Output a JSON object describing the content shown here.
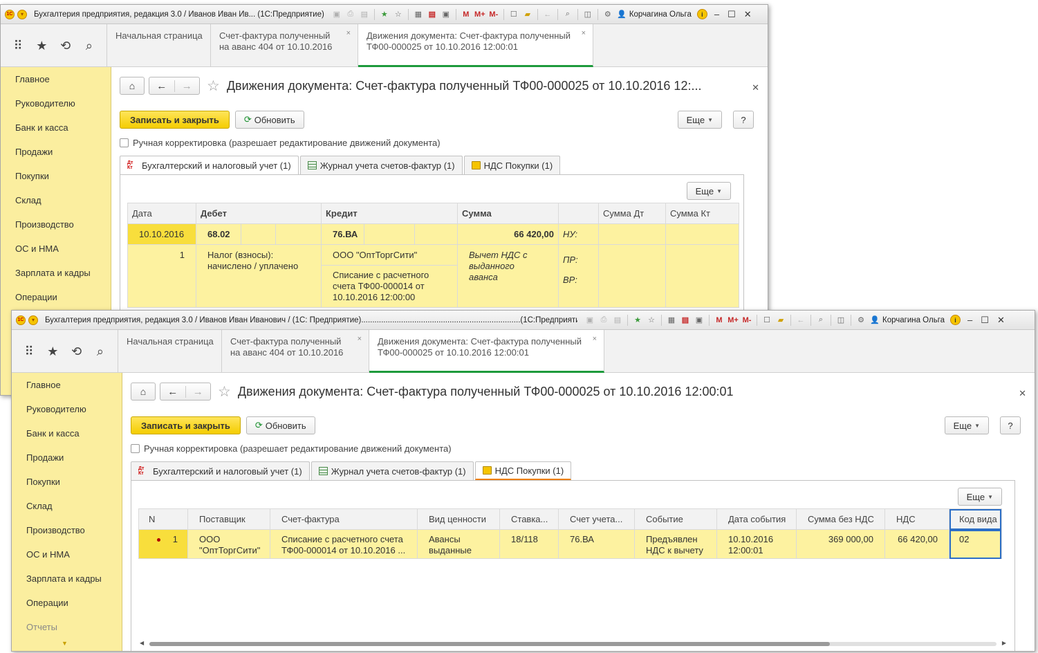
{
  "window1": {
    "title": "Бухгалтерия предприятия, редакция 3.0 / Иванов Иван Ив...  (1С:Предприятие)",
    "user": "Корчагина Ольга",
    "open_tabs": [
      {
        "label": "Начальная страница"
      },
      {
        "label": "Счет-фактура полученный\nна аванс 404 от 10.10.2016"
      },
      {
        "label": "Движения документа: Счет-фактура полученный\nТФ00-000025 от 10.10.2016 12:00:01"
      }
    ],
    "sections": [
      "Главное",
      "Руководителю",
      "Банк и касса",
      "Продажи",
      "Покупки",
      "Склад",
      "Производство",
      "ОС и НМА",
      "Зарплата и кадры",
      "Операции"
    ],
    "form_title": "Движения документа: Счет-фактура полученный ТФ00-000025 от 10.10.2016 12:...",
    "save_close": "Записать и закрыть",
    "refresh": "Обновить",
    "more": "Еще",
    "help": "?",
    "manual_edit": "Ручная корректировка (разрешает редактирование движений документа)",
    "panel_tabs": [
      "Бухгалтерский и налоговый учет (1)",
      "Журнал учета счетов-фактур (1)",
      "НДС Покупки (1)"
    ],
    "panel_more": "Еще",
    "grid": {
      "headers": {
        "date": "Дата",
        "debit": "Дебет",
        "credit": "Кредит",
        "sum": "Сумма",
        "sum_dt": "Сумма Дт",
        "sum_kt": "Сумма Кт"
      },
      "row": {
        "date": "10.10.2016",
        "num": "1",
        "debit_acc": "68.02",
        "debit_sub": "Налог (взносы): начислено / уплачено",
        "credit_acc": "76.ВА",
        "credit_sub1": "ООО \"ОптТоргСити\"",
        "credit_sub2": "Списание с расчетного счета ТФ00-000014 от 10.10.2016 12:00:00",
        "sum": "66 420,00",
        "content": "Вычет НДС с выданного аванса",
        "nu": "НУ:",
        "pr": "ПР:",
        "vr": "ВР:"
      }
    }
  },
  "window2": {
    "title": "Бухгалтерия предприятия, редакция 3.0 / Иванов Иван Иванович / (1С: Предприятие)........................................................................(1С:Предприятие)",
    "user": "Корчагина Ольга",
    "open_tabs": [
      {
        "label": "Начальная страница"
      },
      {
        "label": "Счет-фактура полученный\nна аванс 404 от 10.10.2016"
      },
      {
        "label": "Движения документа: Счет-фактура полученный\nТФ00-000025 от 10.10.2016 12:00:01"
      }
    ],
    "sections": [
      "Главное",
      "Руководителю",
      "Банк и касса",
      "Продажи",
      "Покупки",
      "Склад",
      "Производство",
      "ОС и НМА",
      "Зарплата и кадры",
      "Операции",
      "Отчеты"
    ],
    "form_title": "Движения документа: Счет-фактура полученный ТФ00-000025 от 10.10.2016 12:00:01",
    "save_close": "Записать и закрыть",
    "refresh": "Обновить",
    "more": "Еще",
    "help": "?",
    "manual_edit": "Ручная корректировка (разрешает редактирование движений документа)",
    "panel_tabs": [
      "Бухгалтерский и налоговый учет (1)",
      "Журнал учета счетов-фактур (1)",
      "НДС Покупки (1)"
    ],
    "panel_more": "Еще",
    "grid": {
      "headers": [
        "N",
        "Поставщик",
        "Счет-фактура",
        "Вид ценности",
        "Ставка...",
        "Счет учета...",
        "Событие",
        "Дата события",
        "Сумма без НДС",
        "НДС",
        "Код вида"
      ],
      "row": [
        "1",
        "ООО \"ОптТоргСити\"",
        "Списание с расчетного счета ТФ00-000014 от 10.10.2016 ...",
        "Авансы выданные",
        "18/118",
        "76.ВА",
        "Предъявлен НДС к вычету",
        "10.10.2016 12:00:01",
        "369 000,00",
        "66 420,00",
        "02"
      ]
    }
  },
  "colors": {
    "accent_yellow": "#f4cd00",
    "sidebar": "#fbee9f",
    "row_highlight": "#fdf2a0",
    "active_tab": "#1e9a3c",
    "selection": "#2c6ec6"
  }
}
